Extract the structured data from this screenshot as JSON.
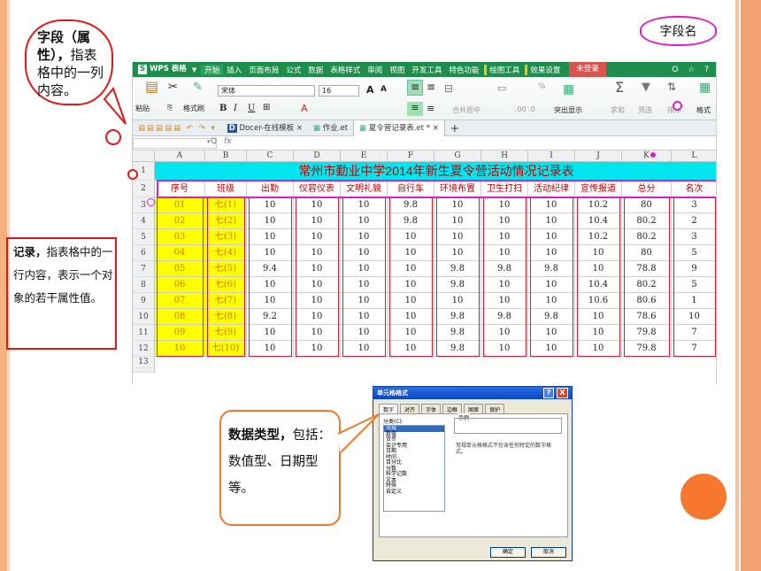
{
  "app": {
    "logo_mark": "S",
    "name": "WPS 表格",
    "login": "未登录",
    "menus": [
      "开始",
      "插入",
      "页面布局",
      "公式",
      "数据",
      "表格样式",
      "审阅",
      "视图",
      "开发工具",
      "特色功能"
    ],
    "menus_marked": [
      "绘图工具",
      "效果设置"
    ],
    "right_icons": "Ο ☆ ?"
  },
  "ribbon": {
    "paste": "粘贴",
    "format_painter": "格式刷",
    "font_name": "宋体",
    "font_size": "16",
    "bold": "B",
    "italic": "I",
    "underline": "U",
    "merge": "合并居中",
    "pct": "%",
    "show_all": "突出显示",
    "sum": "求和",
    "filter": "筛选",
    "sort": "排序",
    "format": "格式",
    "increase_dec": ".00 .0",
    "font_grow": "A",
    "font_shrink": "A",
    "sum_icon": "Σ"
  },
  "file_tabs": [
    {
      "label": "Docer-在线模板"
    },
    {
      "label": "作业.et"
    },
    {
      "label": "夏令营记录表.et *"
    }
  ],
  "tab_close": "×",
  "tab_add": "+",
  "formula": {
    "name_box": "",
    "fx": "fx",
    "zoom_icon": "Q"
  },
  "columns": [
    "A",
    "B",
    "C",
    "D",
    "E",
    "F",
    "G",
    "H",
    "I",
    "J",
    "K",
    "L"
  ],
  "rows": [
    "1",
    "2",
    "3",
    "4",
    "5",
    "6",
    "7",
    "8",
    "9",
    "10",
    "11",
    "12",
    "13"
  ],
  "sheet": {
    "title": "常州市勤业中学2014年新生夏令营活动情况记录表",
    "headers": [
      "序号",
      "班级",
      "出勤",
      "仪容仪表",
      "文明礼貌",
      "自行车",
      "环境布置",
      "卫生打扫",
      "活动纪律",
      "宣传报道",
      "总分",
      "名次"
    ],
    "data": [
      [
        "01",
        "七(1)",
        "10",
        "10",
        "10",
        "9.8",
        "10",
        "10",
        "10",
        "10.2",
        "80",
        "3"
      ],
      [
        "02",
        "七(2)",
        "10",
        "10",
        "10",
        "9.8",
        "10",
        "10",
        "10",
        "10.4",
        "80.2",
        "2"
      ],
      [
        "03",
        "七(3)",
        "10",
        "10",
        "10",
        "10",
        "10",
        "10",
        "10",
        "10.2",
        "80.2",
        "3"
      ],
      [
        "04",
        "七(4)",
        "10",
        "10",
        "10",
        "10",
        "10",
        "10",
        "10",
        "10",
        "80",
        "5"
      ],
      [
        "05",
        "七(5)",
        "9.4",
        "10",
        "10",
        "10",
        "9.8",
        "9.8",
        "9.8",
        "10",
        "78.8",
        "9"
      ],
      [
        "06",
        "七(6)",
        "10",
        "10",
        "10",
        "10",
        "9.8",
        "10",
        "10",
        "10.4",
        "80.2",
        "5"
      ],
      [
        "07",
        "七(7)",
        "10",
        "10",
        "10",
        "10",
        "10",
        "10",
        "10",
        "10.6",
        "80.6",
        "1"
      ],
      [
        "08",
        "七(8)",
        "9.2",
        "10",
        "10",
        "10",
        "9.8",
        "9.8",
        "9.8",
        "10",
        "78.6",
        "10"
      ],
      [
        "09",
        "七(9)",
        "10",
        "10",
        "10",
        "10",
        "9.8",
        "10",
        "10",
        "10",
        "79.8",
        "7"
      ],
      [
        "10",
        "七(10)",
        "10",
        "10",
        "10",
        "10",
        "9.8",
        "10",
        "10",
        "10",
        "79.8",
        "7"
      ]
    ]
  },
  "dialog": {
    "title": "单元格格式",
    "tabs": [
      "数字",
      "对齐",
      "字体",
      "边框",
      "图案",
      "保护"
    ],
    "category_label": "分类(C):",
    "sample_label": "示例",
    "categories": [
      "常规",
      "数值",
      "货币",
      "会计专用",
      "日期",
      "时间",
      "百分比",
      "分数",
      "科学记数",
      "文本",
      "特殊",
      "自定义"
    ],
    "description": "常规单元格格式不包含任何特定的数字格式。",
    "ok": "确定",
    "cancel": "取消",
    "help": "?",
    "close": "X"
  },
  "callouts": {
    "field_bold": "字段（属性），",
    "field_rest": "指表格中的一列内容。",
    "field_name": "字段名",
    "record_bold": "记录，",
    "record_rest": "指表格中的一行内容，表示一个对象的若干属性值。",
    "type_bold": "数据类型，",
    "type_rest": "包括：数值型、日期型等。"
  },
  "colors": {
    "accent_red": "#e01818",
    "magenta": "#e01ec8",
    "title_cyan": "#00e5ee",
    "highlight_yellow": "#ffff00",
    "wps_green": "#1f8e4c",
    "orange": "#f07828"
  }
}
